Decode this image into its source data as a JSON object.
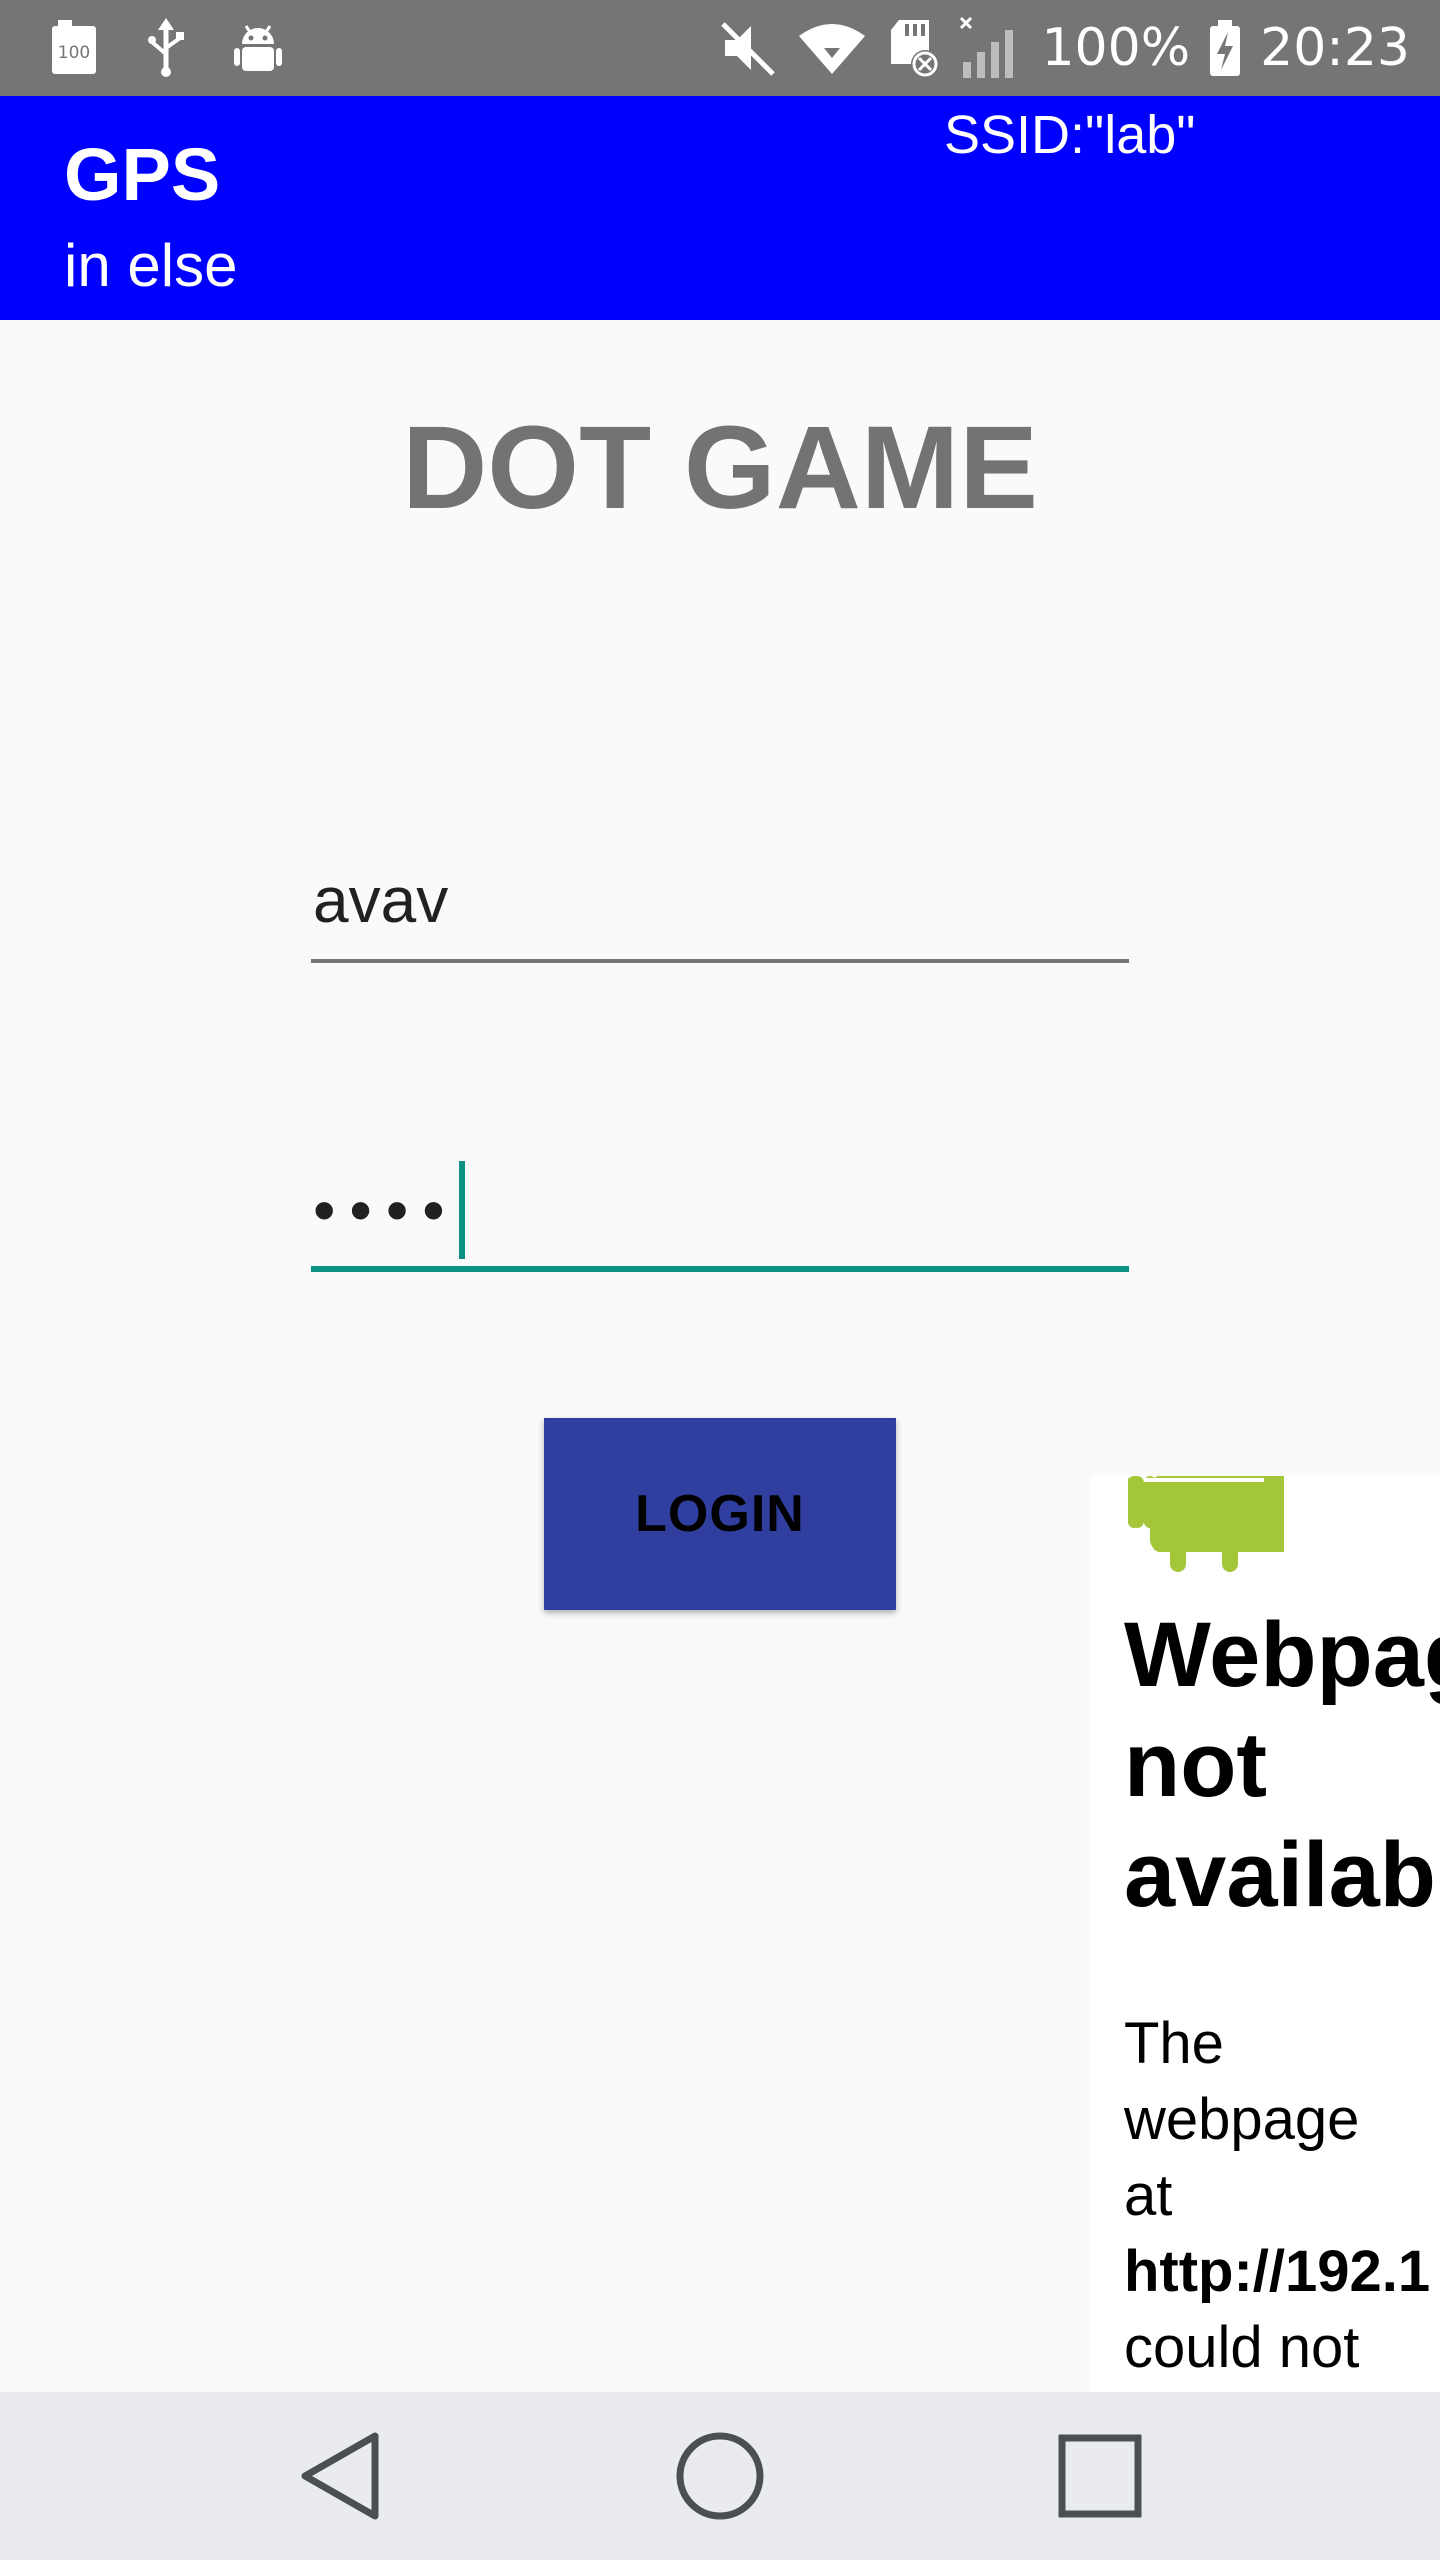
{
  "status_bar": {
    "left_icons": [
      "battery-100-icon",
      "usb-icon",
      "android-debug-icon"
    ],
    "right_icons": [
      "mute-icon",
      "wifi-icon",
      "sd-card-error-icon",
      "signal-no-service-icon"
    ],
    "battery_percent": "100%",
    "time": "20:23"
  },
  "app_bar": {
    "title": "GPS",
    "subtitle": "in else",
    "ssid": "SSID:\"lab\""
  },
  "main": {
    "game_title": "DOT GAME",
    "username_value": "avav",
    "password_value": "••••",
    "login_label": "LOGIN"
  },
  "webview": {
    "heading_lines": [
      "Webpage",
      "not",
      "available"
    ],
    "body_lines": [
      "The",
      "webpage",
      "at",
      "http://192.1",
      "could not"
    ]
  },
  "nav_bar": {
    "buttons": [
      "back-icon",
      "home-icon",
      "recents-icon"
    ]
  },
  "colors": {
    "status_bar": "#757575",
    "app_bar": "#0000ff",
    "accent": "#0a9384",
    "button": "#303f9f",
    "title_gray": "#737373"
  }
}
